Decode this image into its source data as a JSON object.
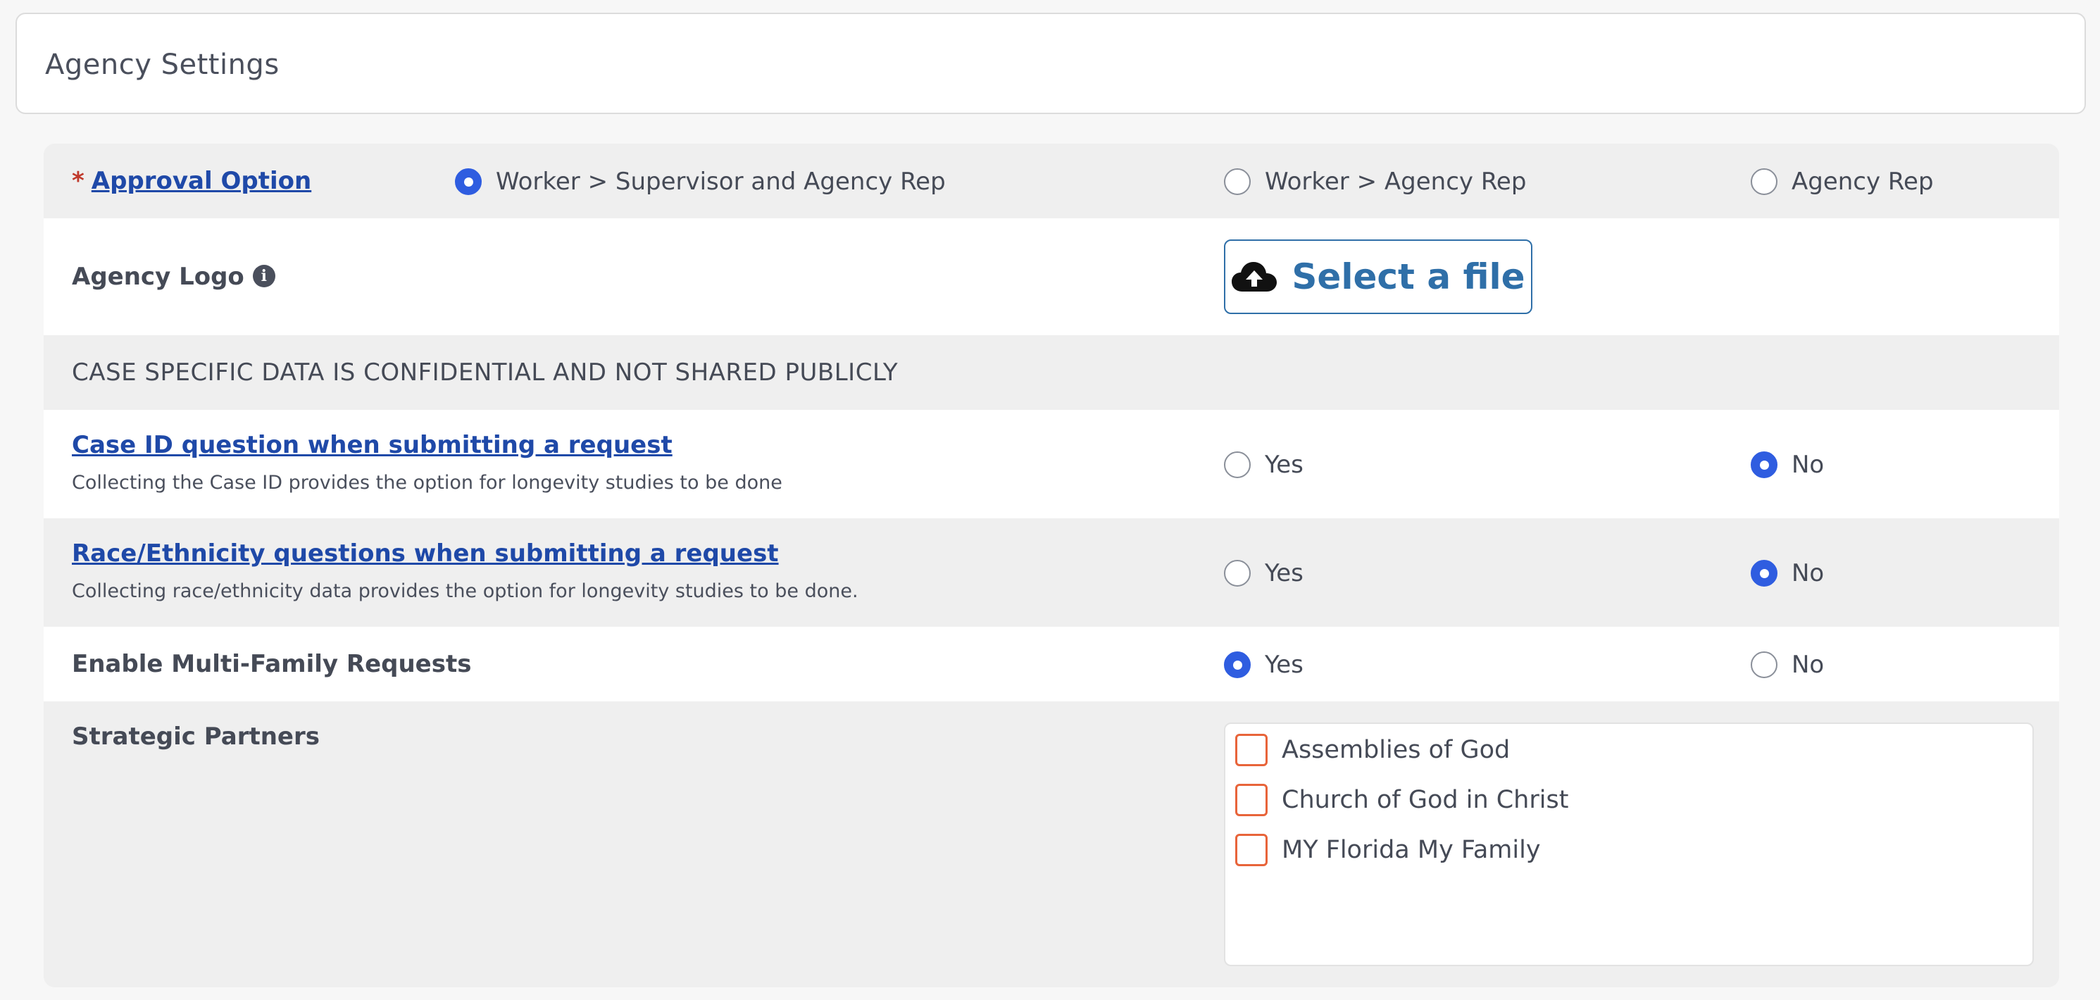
{
  "header": {
    "title": "Agency Settings"
  },
  "approval": {
    "required_mark": "*",
    "label": "Approval Option",
    "options": [
      {
        "label": "Worker > Supervisor and Agency Rep",
        "checked": true
      },
      {
        "label": "Worker > Agency Rep",
        "checked": false
      },
      {
        "label": "Agency Rep",
        "checked": false
      }
    ]
  },
  "logo": {
    "label": "Agency Logo",
    "info_icon": "i",
    "button_label": "Select a file",
    "button_icon": "cloud-upload-icon"
  },
  "confidential": {
    "text": "CASE SPECIFIC DATA IS CONFIDENTIAL AND NOT SHARED PUBLICLY"
  },
  "case_id": {
    "label": "Case ID question when submitting a request",
    "description": "Collecting the Case ID provides the option for longevity studies to be done",
    "yes_label": "Yes",
    "no_label": "No",
    "selected": "No"
  },
  "race": {
    "label": "Race/Ethnicity questions when submitting a request",
    "description": "Collecting race/ethnicity data provides the option for longevity studies to be done.",
    "yes_label": "Yes",
    "no_label": "No",
    "selected": "No"
  },
  "multi_family": {
    "label": "Enable Multi-Family Requests",
    "yes_label": "Yes",
    "no_label": "No",
    "selected": "Yes"
  },
  "partners": {
    "label": "Strategic Partners",
    "items": [
      {
        "label": "Assemblies of God",
        "checked": false
      },
      {
        "label": "Church of God in Christ",
        "checked": false
      },
      {
        "label": "MY Florida My Family",
        "checked": false
      }
    ]
  },
  "colors": {
    "accent": "#2f5de0",
    "link": "#1f49a8",
    "checkbox_border": "#e8643a",
    "file_button": "#2f6fa8",
    "required": "#c0392b"
  }
}
